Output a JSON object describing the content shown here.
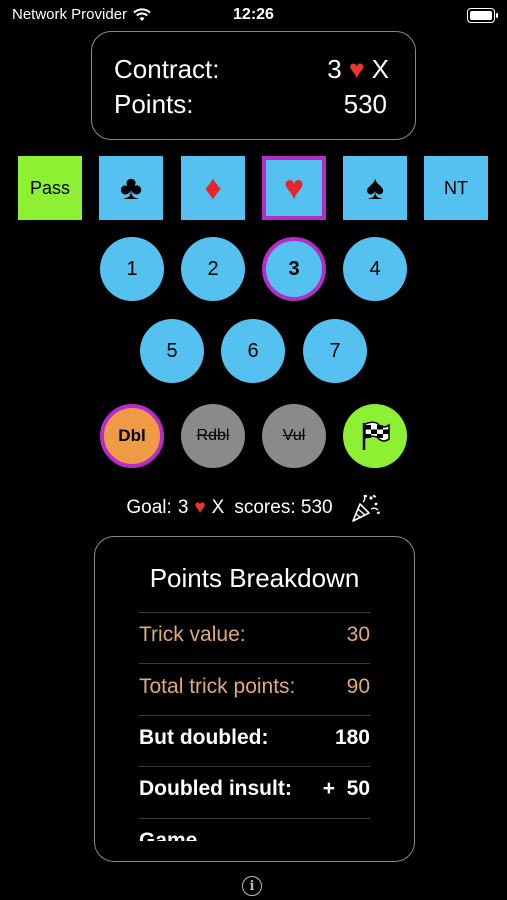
{
  "status": {
    "carrier": "Network Provider",
    "time": "12:26"
  },
  "contract": {
    "contract_label": "Contract:",
    "contract_level": "3",
    "contract_suit": "♥",
    "contract_double": "X",
    "points_label": "Points:",
    "points_value": "530"
  },
  "suits": {
    "pass": "Pass",
    "clubs": "♣",
    "diamonds": "♦",
    "hearts": "♥",
    "spades": "♠",
    "notrump": "NT",
    "selected": "hearts"
  },
  "levels": {
    "l1": "1",
    "l2": "2",
    "l3": "3",
    "l4": "4",
    "l5": "5",
    "l6": "6",
    "l7": "7",
    "selected": "3"
  },
  "modifiers": {
    "dbl": "Dbl",
    "rdbl": "Rdbl",
    "vul": "Vul"
  },
  "goal": {
    "goal_label": "Goal:",
    "level": "3",
    "suit": "♥",
    "double": "X",
    "scores_label": "scores: 530"
  },
  "breakdown": {
    "title": "Points Breakdown",
    "rows": [
      {
        "label": "Trick value:",
        "value": "30"
      },
      {
        "label": "Total trick points:",
        "value": "90"
      },
      {
        "label": "But doubled:",
        "value": "180"
      },
      {
        "label": "Doubled insult:",
        "value": "+  50"
      },
      {
        "label": "Game",
        "value": ""
      }
    ]
  },
  "colors": {
    "accent_blue": "#54c1f0",
    "green": "#8ef033",
    "purple": "#b42cc9",
    "orange": "#ef9a45",
    "heart_red": "#e7252b",
    "tan": "#e0aa75"
  }
}
